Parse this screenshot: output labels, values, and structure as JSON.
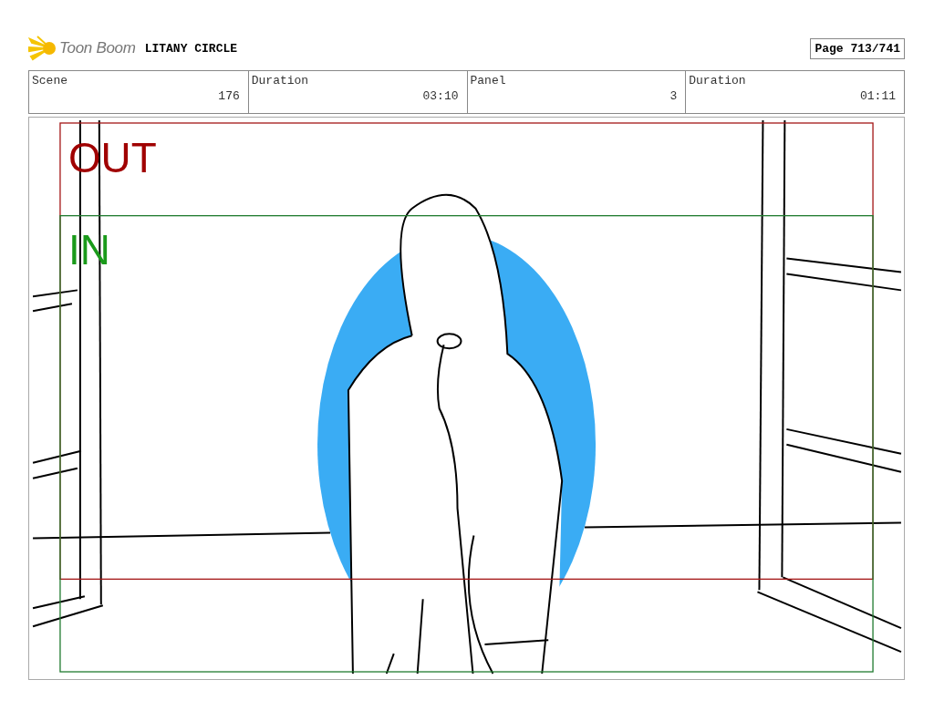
{
  "header": {
    "logo": "Toon Boom",
    "title": "LITANY CIRCLE",
    "page": "Page 713/741"
  },
  "info": [
    {
      "label": "Scene",
      "value": "176"
    },
    {
      "label": "Duration",
      "value": "03:10"
    },
    {
      "label": "Panel",
      "value": "3"
    },
    {
      "label": "Duration",
      "value": "01:11"
    }
  ],
  "panel": {
    "frames": [
      {
        "kind": "out",
        "label": "OUT"
      },
      {
        "kind": "in",
        "label": "IN"
      }
    ]
  }
}
